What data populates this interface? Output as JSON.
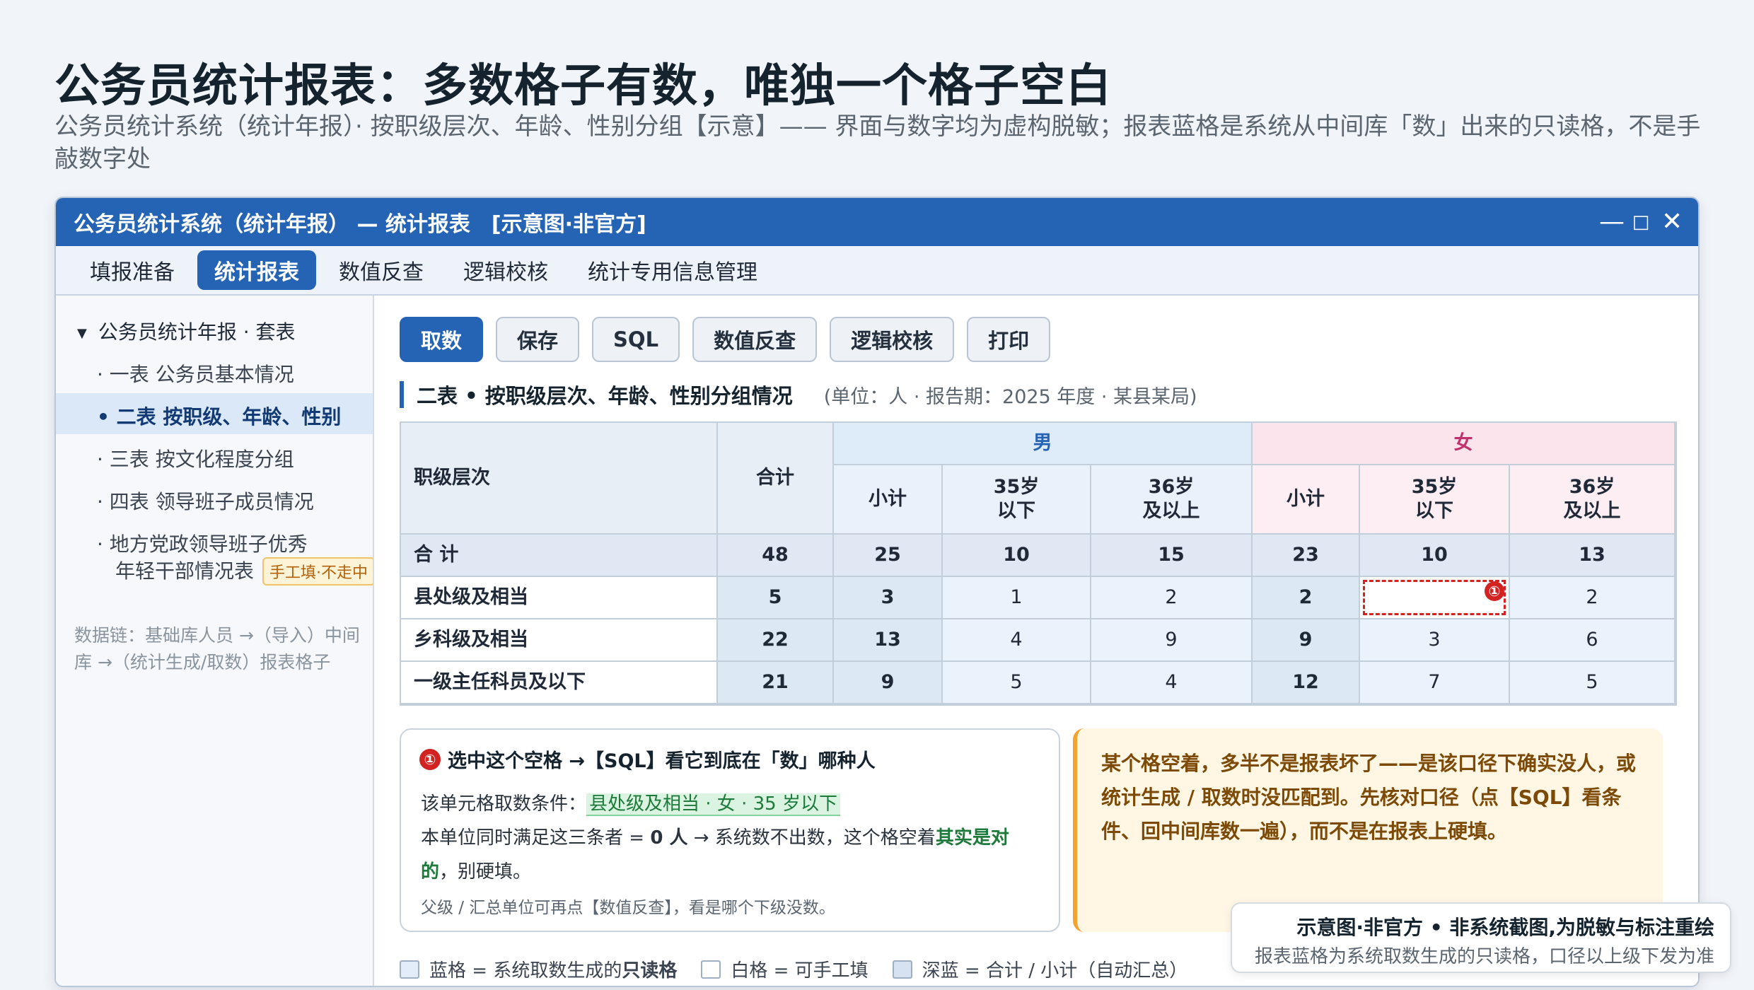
{
  "page": {
    "title": "公务员统计报表：多数格子有数，唯独一个格子空白",
    "subtitle": "公务员统计系统（统计年报）· 按职级层次、年龄、性别分组【示意】—— 界面与数字均为虚构脱敏；报表蓝格是系统从中间库「数」出来的只读格，不是手敲数字处"
  },
  "window": {
    "title": "公务员统计系统（统计年报） — 统计报表",
    "tag": "[示意图·非官方]",
    "controls": {
      "minimize": "—",
      "maximize": "□",
      "close": "✕"
    }
  },
  "menubar": {
    "items": [
      "填报准备",
      "统计报表",
      "数值反查",
      "逻辑校核",
      "统计专用信息管理"
    ],
    "active_index": 1
  },
  "sidebar": {
    "root": "公务员统计年报 · 套表",
    "items": [
      {
        "label": "· 一表 公务员基本情况"
      },
      {
        "label": "• 二表 按职级、年龄、性别",
        "selected": true
      },
      {
        "label": "· 三表 按文化程度分组"
      },
      {
        "label": "· 四表 领导班子成员情况"
      },
      {
        "label": "· 地方党政领导班子优秀"
      },
      {
        "label": "年轻干部情况表",
        "badge": "手工填·不走中"
      }
    ],
    "datachain": "数据链：基础库人员 →（导入）中间库 →（统计生成/取数）报表格子"
  },
  "toolbar": {
    "buttons": [
      "取数",
      "保存",
      "SQL",
      "数值反查",
      "逻辑校核",
      "打印"
    ],
    "primary_index": 0
  },
  "report": {
    "title": "二表 • 按职级层次、年龄、性别分组情况",
    "unit": "(单位：人 · 报告期：2025 年度 · 某县某局)",
    "headers": {
      "rank": "职级层次",
      "total": "合计",
      "male": "男",
      "female": "女",
      "subtotal": "小计",
      "under35": "35岁 以下",
      "over36": "36岁 及以上"
    },
    "rows": [
      {
        "label": "合  计",
        "total": "48",
        "m_sub": "25",
        "m_u35": "10",
        "m_o36": "15",
        "f_sub": "23",
        "f_u35": "10",
        "f_o36": "13"
      },
      {
        "label": "县处级及相当",
        "total": "5",
        "m_sub": "3",
        "m_u35": "1",
        "m_o36": "2",
        "f_sub": "2",
        "f_u35": "",
        "f_o36": "2"
      },
      {
        "label": "乡科级及相当",
        "total": "22",
        "m_sub": "13",
        "m_u35": "4",
        "m_o36": "9",
        "f_sub": "9",
        "f_u35": "3",
        "f_o36": "6"
      },
      {
        "label": "一级主任科员及以下",
        "total": "21",
        "m_sub": "9",
        "m_u35": "5",
        "m_o36": "4",
        "f_sub": "12",
        "f_u35": "7",
        "f_o36": "5"
      }
    ],
    "marker": "①"
  },
  "note_left": {
    "marker": "①",
    "title": "选中这个空格 →【SQL】看它到底在「数」哪种人",
    "cond_prefix": "该单元格取数条件：",
    "cond_value": "县处级及相当 · 女 · 35 岁以下",
    "line2_a": "本单位同时满足这三条者 = ",
    "line2_b": "0 人",
    "line2_c": " → 系统数不出数，这个格空着",
    "line2_d": "其实是对",
    "line3_a": "的",
    "line3_b": "，别硬填。",
    "small": "父级 / 汇总单位可再点【数值反查】，看是哪个下级没数。"
  },
  "note_right": {
    "text": "某个格空着，多半不是报表坏了——是该口径下确实没人，或统计生成 / 取数时没匹配到。先核对口径（点【SQL】看条件、回中间库数一遍），而不是在报表上硬填。"
  },
  "legend": [
    {
      "label_a": "蓝格 = 系统取数生成的 ",
      "label_b": "只读格",
      "color": "#e3edf9"
    },
    {
      "label_a": "白格 = 可手工填",
      "label_b": "",
      "color": "#ffffff"
    },
    {
      "label_a": "深蓝 = 合计 / 小计（自动汇总）",
      "label_b": "",
      "color": "#d6e2f1"
    }
  ],
  "stamp": {
    "line1": "示意图·非官方 • 非系统截图,为脱敏与标注重绘",
    "line2": "报表蓝格为系统取数生成的只读格，口径以上级下发为准"
  },
  "colors": {
    "accent": "#2563b4",
    "male_header": "#deebf8",
    "female_header": "#fce4ec",
    "warning": "#f1a530",
    "error": "#d32222"
  }
}
